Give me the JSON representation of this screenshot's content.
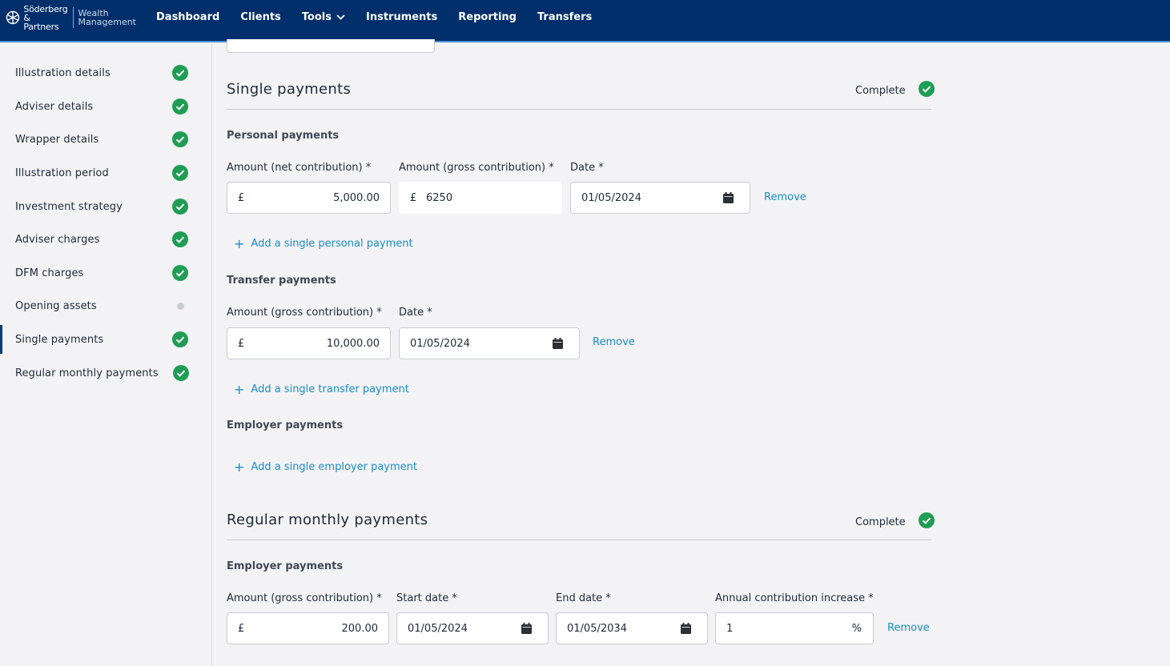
{
  "brand": {
    "name_line1": "Söderberg",
    "name_line2": "& Partners",
    "product_line1": "Wealth",
    "product_line2": "Management"
  },
  "nav": {
    "items": [
      {
        "label": "Dashboard"
      },
      {
        "label": "Clients"
      },
      {
        "label": "Tools",
        "has_dropdown": true
      },
      {
        "label": "Instruments"
      },
      {
        "label": "Reporting"
      },
      {
        "label": "Transfers"
      }
    ]
  },
  "sidebar": {
    "items": [
      {
        "label": "Illustration details",
        "status": "complete"
      },
      {
        "label": "Adviser details",
        "status": "complete"
      },
      {
        "label": "Wrapper details",
        "status": "complete"
      },
      {
        "label": "Illustration period",
        "status": "complete"
      },
      {
        "label": "Investment strategy",
        "status": "complete"
      },
      {
        "label": "Adviser charges",
        "status": "complete"
      },
      {
        "label": "DFM charges",
        "status": "complete"
      },
      {
        "label": "Opening assets",
        "status": "incomplete"
      },
      {
        "label": "Single payments",
        "status": "complete",
        "active": true
      },
      {
        "label": "Regular monthly payments",
        "status": "complete"
      }
    ]
  },
  "single": {
    "title": "Single payments",
    "status": "Complete",
    "personal": {
      "heading": "Personal payments",
      "net_label": "Amount (net contribution) *",
      "gross_label": "Amount (gross contribution) *",
      "date_label": "Date *",
      "currency": "£",
      "net_value": "5,000.00",
      "gross_value": "6250",
      "date_value": "01/05/2024",
      "remove": "Remove",
      "add": "Add a single personal payment"
    },
    "transfer": {
      "heading": "Transfer payments",
      "gross_label": "Amount (gross contribution) *",
      "date_label": "Date *",
      "currency": "£",
      "gross_value": "10,000.00",
      "date_value": "01/05/2024",
      "remove": "Remove",
      "add": "Add a single transfer payment"
    },
    "employer": {
      "heading": "Employer payments",
      "add": "Add a single employer payment"
    }
  },
  "regular": {
    "title": "Regular monthly payments",
    "status": "Complete",
    "employer": {
      "heading": "Employer payments",
      "gross_label": "Amount (gross contribution) *",
      "start_label": "Start date *",
      "end_label": "End date *",
      "increase_label": "Annual contribution increase *",
      "currency": "£",
      "gross_value": "200.00",
      "start_value": "01/05/2024",
      "end_value": "01/05/2034",
      "increase_value": "1",
      "increase_unit": "%",
      "remove": "Remove"
    }
  },
  "colors": {
    "nav_bg": "#002f6c",
    "complete_green": "#1f9d55",
    "link_blue": "#1a8cc9",
    "incomplete_grey": "#c9ccd2"
  }
}
